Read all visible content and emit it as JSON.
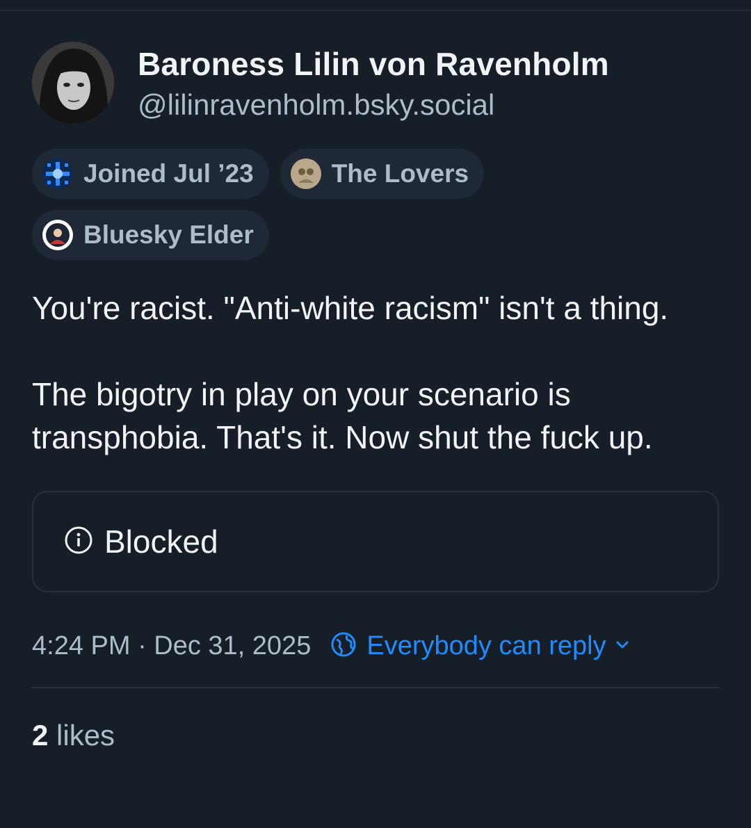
{
  "author": {
    "display_name": "Baroness Lilin von Ravenholm",
    "handle": "@lilinravenholm.bsky.social"
  },
  "badges": [
    {
      "label": "Joined Jul ’23",
      "icon": "joined-badge-icon"
    },
    {
      "label": "The Lovers",
      "icon": "tarot-badge-icon"
    },
    {
      "label": "Bluesky Elder",
      "icon": "elder-badge-icon"
    }
  ],
  "post": {
    "text": "You're racist. \"Anti-white racism\" isn't a thing.\n\nThe bigotry in play on your scenario is transphobia. That's it. Now shut the fuck up.",
    "embed": {
      "label": "Blocked",
      "icon": "info-icon"
    }
  },
  "meta": {
    "timestamp": "4:24 PM · Dec 31, 2025",
    "reply_setting": "Everybody can reply"
  },
  "likes": {
    "count": "2",
    "label": "likes"
  },
  "colors": {
    "background": "#161e27",
    "accent": "#208bfe",
    "muted_text": "#aebbc9",
    "primary_text": "#f1f3f5"
  }
}
